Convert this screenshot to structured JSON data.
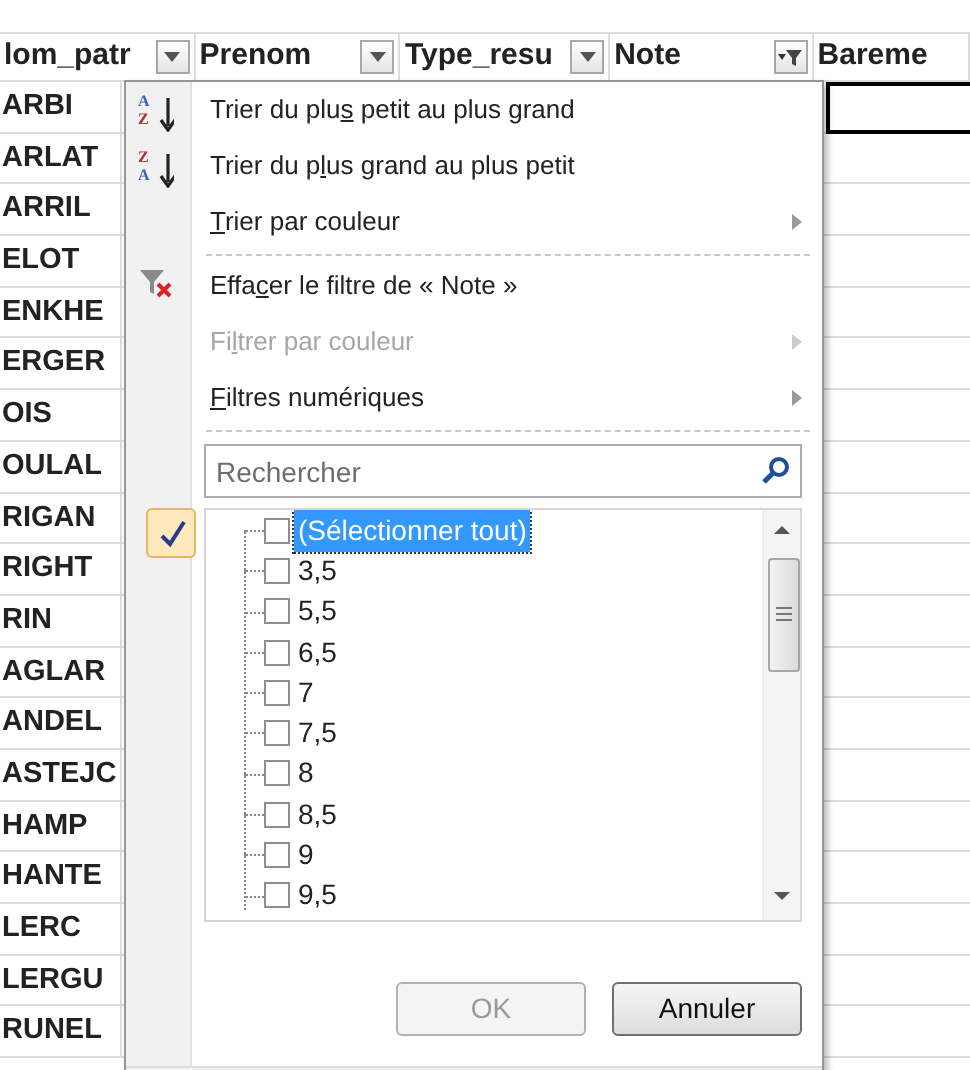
{
  "sheet": {
    "headers": [
      {
        "label": "lom_patr",
        "filtered": false
      },
      {
        "label": "Prenom",
        "filtered": false
      },
      {
        "label": "Type_resu",
        "filtered": false
      },
      {
        "label": "Note",
        "filtered": true
      },
      {
        "label": "Bareme"
      }
    ],
    "rows": [
      "ARBI",
      "ARLAT",
      "ARRIL",
      "ELOT",
      "ENKHE",
      "ERGER",
      "OIS",
      "OULAL",
      "RIGAN",
      "RIGHT",
      "RIN",
      "AGLAR",
      "ANDEL",
      "ASTEJC",
      "HAMP",
      "HANTE",
      "LERC",
      "LERGU",
      "RUNEL"
    ]
  },
  "filter_menu": {
    "items": [
      {
        "kind": "sort",
        "icon_top": "A",
        "icon_bottom": "Z",
        "before": "Trier du plu",
        "key": "s",
        "after": " petit au plus grand",
        "disabled": false,
        "submenu": false
      },
      {
        "kind": "sort",
        "icon_top": "Z",
        "icon_bottom": "A",
        "before": "Trier du p",
        "key": "l",
        "after": "us grand au plus petit",
        "disabled": false,
        "submenu": false
      },
      {
        "kind": "plain",
        "key": "T",
        "after": "rier par couleur",
        "disabled": false,
        "submenu": true
      },
      {
        "kind": "separator"
      },
      {
        "kind": "clear-filter",
        "before": "Effa",
        "key": "c",
        "after": "er le filtre de « Note »",
        "disabled": false,
        "submenu": false
      },
      {
        "kind": "plain",
        "before": "Fi",
        "key": "l",
        "after": "trer par couleur",
        "disabled": true,
        "submenu": true
      },
      {
        "kind": "plain",
        "key": "F",
        "after": "iltres numériques",
        "disabled": false,
        "submenu": true
      },
      {
        "kind": "separator"
      }
    ],
    "search": {
      "placeholder": "Rechercher"
    },
    "values": [
      {
        "label": "(Sélectionner tout)",
        "checked": false,
        "selected": true
      },
      {
        "label": "3,5",
        "checked": false,
        "selected": false
      },
      {
        "label": "5,5",
        "checked": false,
        "selected": false
      },
      {
        "label": "6,5",
        "checked": false,
        "selected": false
      },
      {
        "label": "7",
        "checked": false,
        "selected": false
      },
      {
        "label": "7,5",
        "checked": false,
        "selected": false
      },
      {
        "label": "8",
        "checked": false,
        "selected": false
      },
      {
        "label": "8,5",
        "checked": false,
        "selected": false
      },
      {
        "label": "9",
        "checked": false,
        "selected": false
      },
      {
        "label": "9,5",
        "checked": false,
        "selected": false
      }
    ],
    "buttons": [
      {
        "label": "OK",
        "disabled": true
      },
      {
        "label": "Annuler",
        "disabled": false
      }
    ]
  }
}
